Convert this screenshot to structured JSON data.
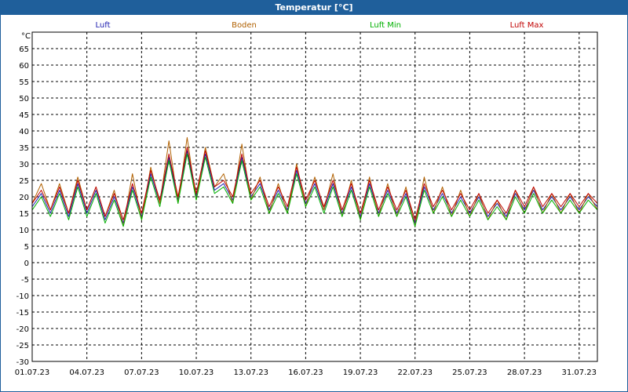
{
  "window": {
    "title": "Temperatur [°C]"
  },
  "chart_data": {
    "type": "line",
    "title": "Temperatur [°C]",
    "ylabel": "°C",
    "xlabel": "",
    "ylim": [
      -30,
      70
    ],
    "yticks": [
      -30,
      -25,
      -20,
      -15,
      -10,
      -5,
      0,
      5,
      10,
      15,
      20,
      25,
      30,
      35,
      40,
      45,
      50,
      55,
      60,
      65
    ],
    "xlim": [
      "01.07.23",
      "01.08.23"
    ],
    "xtick_labels": [
      "01.07.23",
      "04.07.23",
      "07.07.23",
      "10.07.23",
      "13.07.23",
      "16.07.23",
      "19.07.23",
      "22.07.23",
      "25.07.23",
      "28.07.23",
      "31.07.23"
    ],
    "grid": true,
    "legend_position": "top",
    "series": [
      {
        "name": "Luft",
        "color": "#2020b0",
        "x": [
          "01.07.23",
          "01.07.23 12:00",
          "02.07.23",
          "02.07.23 12:00",
          "03.07.23",
          "03.07.23 12:00",
          "04.07.23",
          "04.07.23 12:00",
          "05.07.23",
          "05.07.23 12:00",
          "06.07.23",
          "06.07.23 12:00",
          "07.07.23",
          "07.07.23 12:00",
          "08.07.23",
          "08.07.23 12:00",
          "09.07.23",
          "09.07.23 12:00",
          "10.07.23",
          "10.07.23 12:00",
          "11.07.23",
          "11.07.23 12:00",
          "12.07.23",
          "12.07.23 12:00",
          "13.07.23",
          "13.07.23 12:00",
          "14.07.23",
          "14.07.23 12:00",
          "15.07.23",
          "15.07.23 12:00",
          "16.07.23",
          "16.07.23 12:00",
          "17.07.23",
          "17.07.23 12:00",
          "18.07.23",
          "18.07.23 12:00",
          "19.07.23",
          "19.07.23 12:00",
          "20.07.23",
          "20.07.23 12:00",
          "21.07.23",
          "21.07.23 12:00",
          "22.07.23",
          "22.07.23 12:00",
          "23.07.23",
          "23.07.23 12:00",
          "24.07.23",
          "24.07.23 12:00",
          "25.07.23",
          "25.07.23 12:00",
          "26.07.23",
          "26.07.23 12:00",
          "27.07.23",
          "27.07.23 12:00",
          "28.07.23",
          "28.07.23 12:00",
          "29.07.23",
          "29.07.23 12:00",
          "30.07.23",
          "30.07.23 12:00",
          "31.07.23",
          "31.07.23 12:00",
          "01.08.23"
        ],
        "y": [
          17,
          21,
          15,
          22,
          14,
          24,
          15,
          22,
          13,
          20,
          12,
          23,
          14,
          27,
          18,
          32,
          19,
          34,
          20,
          33,
          22,
          24,
          19,
          32,
          20,
          24,
          16,
          22,
          16,
          28,
          18,
          24,
          16,
          24,
          15,
          23,
          14,
          24,
          15,
          22,
          15,
          21,
          12,
          23,
          16,
          21,
          15,
          20,
          15,
          20,
          14,
          18,
          14,
          21,
          16,
          22,
          16,
          20,
          16,
          20,
          16,
          20,
          17
        ]
      },
      {
        "name": "Boden",
        "color": "#b06000",
        "x": [
          "01.07.23",
          "01.07.23 12:00",
          "02.07.23",
          "02.07.23 12:00",
          "03.07.23",
          "03.07.23 12:00",
          "04.07.23",
          "04.07.23 12:00",
          "05.07.23",
          "05.07.23 12:00",
          "06.07.23",
          "06.07.23 12:00",
          "07.07.23",
          "07.07.23 12:00",
          "08.07.23",
          "08.07.23 12:00",
          "09.07.23",
          "09.07.23 12:00",
          "10.07.23",
          "10.07.23 12:00",
          "11.07.23",
          "11.07.23 12:00",
          "12.07.23",
          "12.07.23 12:00",
          "13.07.23",
          "13.07.23 12:00",
          "14.07.23",
          "14.07.23 12:00",
          "15.07.23",
          "15.07.23 12:00",
          "16.07.23",
          "16.07.23 12:00",
          "17.07.23",
          "17.07.23 12:00",
          "18.07.23",
          "18.07.23 12:00",
          "19.07.23",
          "19.07.23 12:00",
          "20.07.23",
          "20.07.23 12:00",
          "21.07.23",
          "21.07.23 12:00",
          "22.07.23",
          "22.07.23 12:00",
          "23.07.23",
          "23.07.23 12:00",
          "24.07.23",
          "24.07.23 12:00",
          "25.07.23",
          "25.07.23 12:00",
          "26.07.23",
          "26.07.23 12:00",
          "27.07.23",
          "27.07.23 12:00",
          "28.07.23",
          "28.07.23 12:00",
          "29.07.23",
          "29.07.23 12:00",
          "30.07.23",
          "30.07.23 12:00",
          "31.07.23",
          "31.07.23 12:00",
          "01.08.23"
        ],
        "y": [
          18,
          24,
          16,
          24,
          15,
          26,
          16,
          23,
          14,
          22,
          11,
          27,
          13,
          29,
          18,
          37,
          18,
          38,
          19,
          35,
          23,
          27,
          18,
          36,
          19,
          26,
          15,
          24,
          15,
          30,
          17,
          26,
          16,
          27,
          14,
          25,
          13,
          26,
          14,
          24,
          14,
          23,
          11,
          26,
          15,
          23,
          14,
          22,
          14,
          21,
          13,
          19,
          13,
          22,
          15,
          23,
          15,
          21,
          15,
          21,
          15,
          21,
          16
        ]
      },
      {
        "name": "Luft Min",
        "color": "#00b000",
        "x": [
          "01.07.23",
          "01.07.23 12:00",
          "02.07.23",
          "02.07.23 12:00",
          "03.07.23",
          "03.07.23 12:00",
          "04.07.23",
          "04.07.23 12:00",
          "05.07.23",
          "05.07.23 12:00",
          "06.07.23",
          "06.07.23 12:00",
          "07.07.23",
          "07.07.23 12:00",
          "08.07.23",
          "08.07.23 12:00",
          "09.07.23",
          "09.07.23 12:00",
          "10.07.23",
          "10.07.23 12:00",
          "11.07.23",
          "11.07.23 12:00",
          "12.07.23",
          "12.07.23 12:00",
          "13.07.23",
          "13.07.23 12:00",
          "14.07.23",
          "14.07.23 12:00",
          "15.07.23",
          "15.07.23 12:00",
          "16.07.23",
          "16.07.23 12:00",
          "17.07.23",
          "17.07.23 12:00",
          "18.07.23",
          "18.07.23 12:00",
          "19.07.23",
          "19.07.23 12:00",
          "20.07.23",
          "20.07.23 12:00",
          "21.07.23",
          "21.07.23 12:00",
          "22.07.23",
          "22.07.23 12:00",
          "23.07.23",
          "23.07.23 12:00",
          "24.07.23",
          "24.07.23 12:00",
          "25.07.23",
          "25.07.23 12:00",
          "26.07.23",
          "26.07.23 12:00",
          "27.07.23",
          "27.07.23 12:00",
          "28.07.23",
          "28.07.23 12:00",
          "29.07.23",
          "29.07.23 12:00",
          "30.07.23",
          "30.07.23 12:00",
          "31.07.23",
          "31.07.23 12:00",
          "01.08.23"
        ],
        "y": [
          16,
          20,
          14,
          21,
          13,
          23,
          14,
          21,
          12,
          19,
          11,
          22,
          13,
          26,
          17,
          31,
          18,
          33,
          19,
          32,
          21,
          23,
          18,
          31,
          19,
          23,
          15,
          21,
          15,
          27,
          17,
          23,
          15,
          23,
          14,
          22,
          13,
          23,
          14,
          21,
          14,
          20,
          11,
          22,
          15,
          20,
          14,
          19,
          14,
          19,
          13,
          17,
          13,
          20,
          15,
          21,
          15,
          19,
          15,
          19,
          15,
          19,
          16
        ]
      },
      {
        "name": "Luft Max",
        "color": "#c00000",
        "x": [
          "01.07.23",
          "01.07.23 12:00",
          "02.07.23",
          "02.07.23 12:00",
          "03.07.23",
          "03.07.23 12:00",
          "04.07.23",
          "04.07.23 12:00",
          "05.07.23",
          "05.07.23 12:00",
          "06.07.23",
          "06.07.23 12:00",
          "07.07.23",
          "07.07.23 12:00",
          "08.07.23",
          "08.07.23 12:00",
          "09.07.23",
          "09.07.23 12:00",
          "10.07.23",
          "10.07.23 12:00",
          "11.07.23",
          "11.07.23 12:00",
          "12.07.23",
          "12.07.23 12:00",
          "13.07.23",
          "13.07.23 12:00",
          "14.07.23",
          "14.07.23 12:00",
          "15.07.23",
          "15.07.23 12:00",
          "16.07.23",
          "16.07.23 12:00",
          "17.07.23",
          "17.07.23 12:00",
          "18.07.23",
          "18.07.23 12:00",
          "19.07.23",
          "19.07.23 12:00",
          "20.07.23",
          "20.07.23 12:00",
          "21.07.23",
          "21.07.23 12:00",
          "22.07.23",
          "22.07.23 12:00",
          "23.07.23",
          "23.07.23 12:00",
          "24.07.23",
          "24.07.23 12:00",
          "25.07.23",
          "25.07.23 12:00",
          "26.07.23",
          "26.07.23 12:00",
          "27.07.23",
          "27.07.23 12:00",
          "28.07.23",
          "28.07.23 12:00",
          "29.07.23",
          "29.07.23 12:00",
          "30.07.23",
          "30.07.23 12:00",
          "31.07.23",
          "31.07.23 12:00",
          "01.08.23"
        ],
        "y": [
          18,
          22,
          16,
          23,
          15,
          25,
          16,
          23,
          14,
          21,
          13,
          24,
          15,
          28,
          19,
          33,
          20,
          35,
          21,
          34,
          23,
          25,
          20,
          33,
          21,
          25,
          17,
          23,
          17,
          29,
          19,
          25,
          17,
          25,
          16,
          24,
          15,
          25,
          16,
          23,
          16,
          22,
          13,
          24,
          17,
          22,
          16,
          21,
          16,
          21,
          15,
          19,
          15,
          22,
          17,
          23,
          17,
          21,
          17,
          21,
          17,
          21,
          18
        ]
      }
    ]
  }
}
